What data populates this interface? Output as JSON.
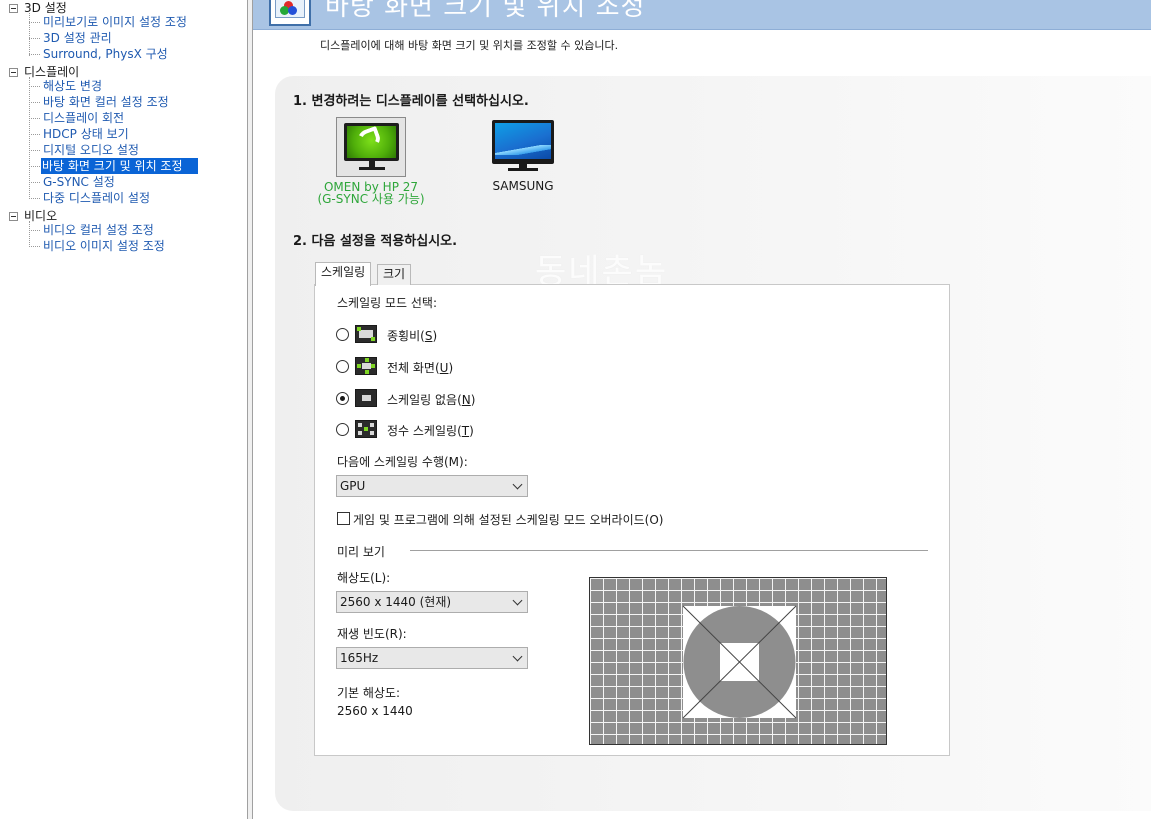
{
  "tree": {
    "groups": [
      {
        "label": "3D 설정",
        "items": [
          "미리보기로 이미지 설정 조정",
          "3D 설정 관리",
          "Surround, PhysX 구성"
        ]
      },
      {
        "label": "디스플레이",
        "items": [
          "해상도 변경",
          "바탕 화면 컬러 설정 조정",
          "디스플레이 회전",
          "HDCP 상태 보기",
          "디지털 오디오 설정",
          "바탕 화면 크기 및 위치 조정",
          "G-SYNC 설정",
          "다중 디스플레이 설정"
        ]
      },
      {
        "label": "비디오",
        "items": [
          "비디오 컬러 설정 조정",
          "비디오 이미지 설정 조정"
        ]
      }
    ],
    "selected": "바탕 화면 크기 및 위치 조정"
  },
  "header": {
    "title": "바탕 화면 크기 및 위치 조정",
    "description": "디스플레이에 대해 바탕 화면 크기 및 위치를 조정할 수 있습니다."
  },
  "step1": {
    "label": "1. 변경하려는 디스플레이를 선택하십시오.",
    "displays": [
      {
        "name": "OMEN by HP 27\n(G-SYNC 사용 가능)",
        "selected": true,
        "color": "#2ea63a",
        "icon": "nvidia-monitor-icon"
      },
      {
        "name": "SAMSUNG",
        "selected": false,
        "icon": "monitor-icon"
      }
    ]
  },
  "step2": {
    "label": "2. 다음 설정을 적용하십시오."
  },
  "watermark": "동네촌놈",
  "tabs": [
    {
      "label": "스케일링",
      "active": true
    },
    {
      "label": "크기",
      "active": false
    }
  ],
  "scaling": {
    "mode_label": "스케일링 모드 선택:",
    "modes": [
      {
        "label": "종횡비",
        "key": "S",
        "checked": false,
        "icon": "aspect-ratio-icon"
      },
      {
        "label": "전체 화면",
        "key": "U",
        "checked": false,
        "icon": "fullscreen-icon"
      },
      {
        "label": "스케일링 없음",
        "key": "N",
        "checked": true,
        "icon": "no-scaling-icon"
      },
      {
        "label": "정수 스케일링",
        "key": "T",
        "checked": false,
        "icon": "integer-scaling-icon"
      }
    ],
    "perform_label": "다음에 스케일링 수행(M):",
    "perform_value": "GPU",
    "override_label": "게임 및 프로그램에 의해 설정된 스케일링 모드 오버라이드(O)",
    "override_checked": false
  },
  "preview": {
    "section_label": "미리 보기",
    "resolution_label": "해상도(L):",
    "resolution_value": "2560 x 1440 (현재)",
    "refresh_label": "재생 빈도(R):",
    "refresh_value": "165Hz",
    "native_label": "기본 해상도:",
    "native_value": "2560 x 1440"
  }
}
